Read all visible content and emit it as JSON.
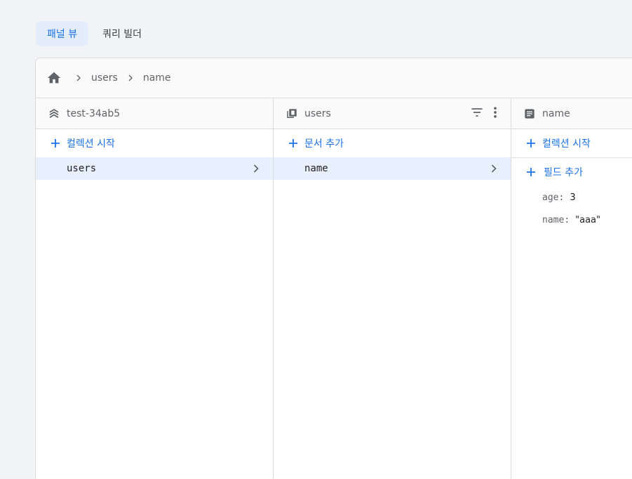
{
  "view_tabs": {
    "panel_view": "패널 뷰",
    "query_builder": "쿼리 빌더"
  },
  "breadcrumb": {
    "items": [
      "users",
      "name"
    ]
  },
  "panels": {
    "root": {
      "title": "test-34ab5",
      "action": "컬렉션 시작",
      "items": [
        "users"
      ]
    },
    "collection": {
      "title": "users",
      "action": "문서 추가",
      "items": [
        "name"
      ]
    },
    "document": {
      "title": "name",
      "action_collection": "컬렉션 시작",
      "action_field": "필드 추가",
      "fields": [
        {
          "key": "age",
          "sep": ":",
          "value": "3"
        },
        {
          "key": "name",
          "sep": ":",
          "value": "\"aaa\""
        }
      ]
    }
  },
  "colors": {
    "accent": "#1a73e8",
    "selected_row": "#e8f0fe",
    "active_tab": "#e3edfb",
    "border": "#dadce0",
    "background": "#f1f3f4"
  }
}
